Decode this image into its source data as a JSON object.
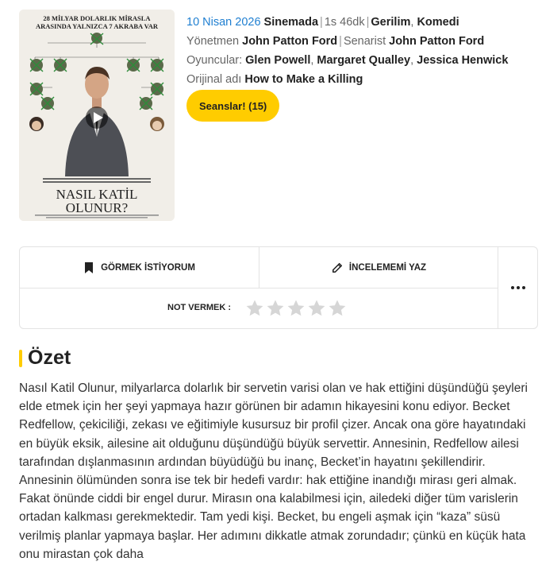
{
  "poster": {
    "tagline_line1": "28 MİLYAR DOLARLIK MİRASLA",
    "tagline_line2": "ARASINDA YALNIZCA 7 AKRABA VAR",
    "title_line1": "NASIL KATİL",
    "title_line2": "OLUNUR?"
  },
  "meta": {
    "date": "10 Nisan 2026",
    "venue": "Sinemada",
    "duration": "1s 46dk",
    "genres": [
      "Gerilim",
      "Komedi"
    ],
    "director_label": "Yönetmen",
    "director": "John Patton Ford",
    "writer_label": "Senarist",
    "writer": "John Patton Ford",
    "cast_label": "Oyuncular:",
    "cast": [
      "Glen Powell",
      "Margaret Qualley",
      "Jessica Henwick"
    ],
    "original_title_label": "Orijinal adı",
    "original_title": "How to Make a Killing",
    "sessions_button": "Seanslar! (15)"
  },
  "actions": {
    "watchlist": "GÖRMEK İSTİYORUM",
    "review": "İNCELEMEMİ YAZ",
    "rate_label": "NOT VERMEK :",
    "rating_value": 0,
    "rating_max": 5
  },
  "summary": {
    "title": "Özet",
    "text": "Nasıl Katil Olunur, milyarlarca dolarlık bir servetin varisi olan ve hak ettiğini düşündüğü şeyleri elde etmek için her şeyi yapmaya hazır görünen bir adamın hikayesini konu ediyor. Becket Redfellow, çekiciliği, zekası ve eğitimiyle kusursuz bir profil çizer. Ancak ona göre hayatındaki en büyük eksik, ailesine ait olduğunu düşündüğü büyük servettir. Annesinin, Redfellow ailesi tarafından dışlanmasının ardından büyüdüğü bu inanç, Becket’in hayatını şekillendirir. Annesinin ölümünden sonra ise tek bir hedefi vardır: hak ettiğine inandığı mirası geri almak. Fakat önünde ciddi bir engel durur. Mirasın ona kalabilmesi için, ailedeki diğer tüm varislerin ortadan kalkması gerekmektedir. Tam yedi kişi. Becket, bu engeli aşmak için “kaza” süsü verilmiş planlar yapmaya başlar. Her adımını dikkatle atmak zorundadır; çünkü en küçük hata onu mirastan çok daha"
  },
  "colors": {
    "accent": "#ffcc00",
    "link_blue": "#1f7fd1",
    "star_empty": "#d6d6d6"
  }
}
